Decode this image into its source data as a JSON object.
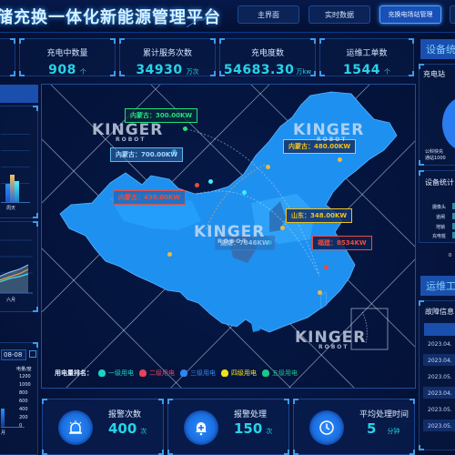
{
  "header": {
    "title": "储充换一体化新能源管理平台",
    "nav": [
      {
        "label": "主界面",
        "active": false
      },
      {
        "label": "实时数据",
        "active": false
      },
      {
        "label": "充换电场站管理",
        "active": true
      }
    ]
  },
  "stats": [
    {
      "label": "充电中数量",
      "value": "908",
      "unit": "个"
    },
    {
      "label": "累计服务次数",
      "value": "34930",
      "unit": "万次"
    },
    {
      "label": "充电度数",
      "value": "54683.30",
      "unit": "万kw"
    },
    {
      "label": "运维工单数",
      "value": "1544",
      "unit": "个"
    }
  ],
  "left": {
    "bar_chart": {
      "xlabel": "周天"
    },
    "line_chart": {
      "xlabel": "六月"
    },
    "date_value": "08-08",
    "axis": {
      "unit": "电量/度",
      "ticks": [
        "1200",
        "1000",
        "800",
        "600",
        "400",
        "200",
        "0"
      ],
      "xlabel": "月"
    }
  },
  "right": {
    "section1_title": "设备统",
    "station_panel": {
      "title": "充电站",
      "legend_line1": "公科快充",
      "legend_line2": "通站1000"
    },
    "device_panel": {
      "title": "设备统计",
      "items": [
        "摄像头",
        "道闸",
        "地锁",
        "充电桩"
      ],
      "axis_zero": "0"
    },
    "section2_title": "运维工",
    "fault_panel": {
      "title": "故障信息",
      "rows": [
        "2023.04.",
        "2023.04.",
        "2023.05.",
        "2023.04.",
        "2023.05.",
        "2023.05."
      ]
    }
  },
  "map": {
    "tooltips": [
      {
        "region": "内蒙古",
        "value": "300.00KW",
        "color": "#22e07a"
      },
      {
        "region": "内蒙古",
        "value": "700.00KW",
        "color": "#5db8e8"
      },
      {
        "region": "内蒙古",
        "value": "480.00KW",
        "color": "#f2c21b"
      },
      {
        "region": "内蒙古",
        "value": "430.00KW",
        "color": "#ee4b3a"
      },
      {
        "region": "山东",
        "value": "348.00KW",
        "color": "#f2c21b"
      },
      {
        "region": "湖南",
        "value": "7846KW",
        "color": "#5db8e8"
      },
      {
        "region": "福建",
        "value": "8534KW",
        "color": "#ee4b3a"
      }
    ],
    "watermark": {
      "brand": "KINGER",
      "sub": "ROBOT"
    },
    "legend": {
      "title": "用电量排名：",
      "items": [
        {
          "label": "一级用电",
          "color": "#18d4c8"
        },
        {
          "label": "二级用电",
          "color": "#e8435a"
        },
        {
          "label": "三级用电",
          "color": "#2f86f0"
        },
        {
          "label": "四级用电",
          "color": "#f2e21b"
        },
        {
          "label": "五级用电",
          "color": "#18c98a"
        }
      ]
    }
  },
  "kpis": [
    {
      "label": "报警次数",
      "value": "400",
      "unit": "次",
      "icon": "alarm-light-icon"
    },
    {
      "label": "报警处理",
      "value": "150",
      "unit": "次",
      "icon": "bell-plus-icon"
    },
    {
      "label": "平均处理时间",
      "value": "5",
      "unit": "分钟",
      "icon": "clock-icon"
    }
  ]
}
